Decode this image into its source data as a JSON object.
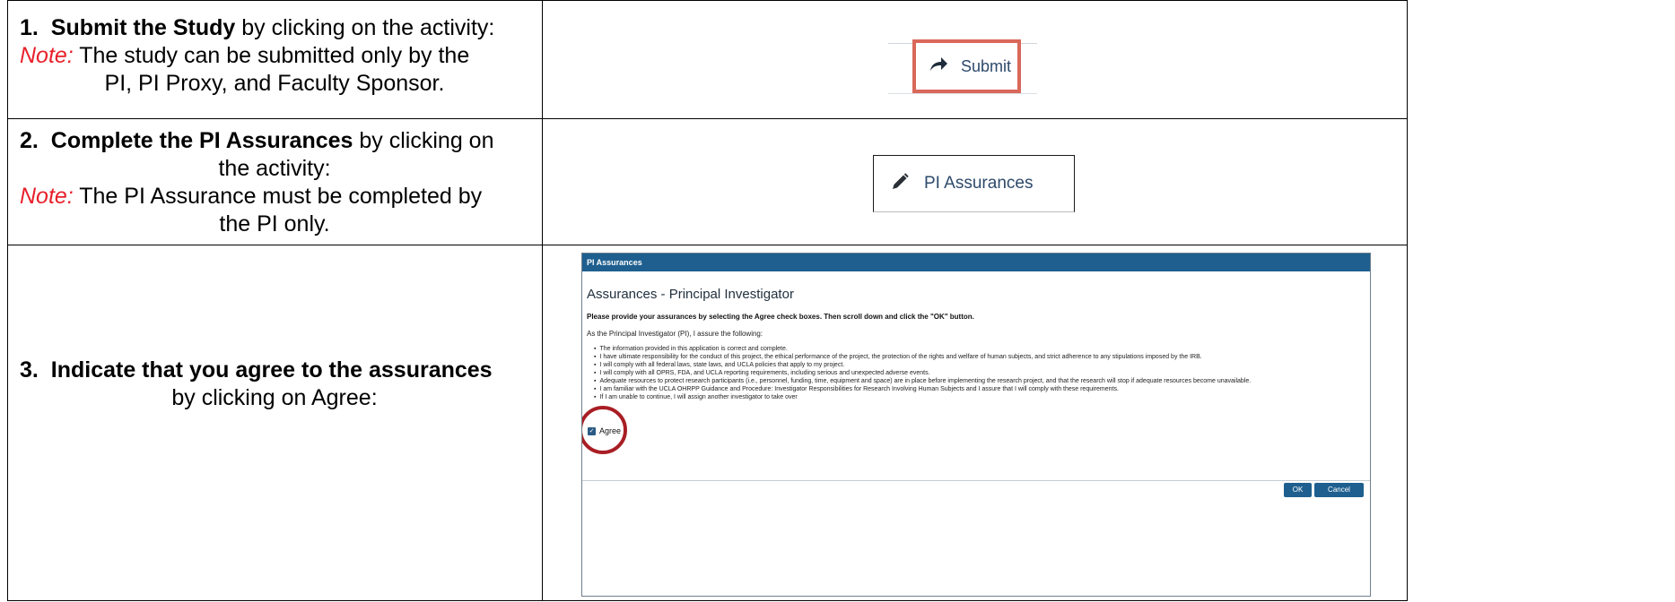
{
  "rows": [
    {
      "num": "1.",
      "title": "Submit the Study",
      "title_rest": " by clicking on the activity:",
      "note_label": "Note:",
      "note_text": " The study can be submitted only by the",
      "note_text2": "PI, PI Proxy, and Faculty Sponsor."
    },
    {
      "num": "2.",
      "title": "Complete the PI Assurances",
      "title_rest": " by clicking on",
      "title_rest2": "the activity:",
      "note_label": "Note:",
      "note_text": " The PI Assurance must be completed by",
      "note_text2": "the PI only."
    },
    {
      "num": "3.",
      "title": "Indicate that you agree to the assurances",
      "title_rest": "by clicking on Agree:"
    }
  ],
  "submit_image": {
    "label": "Submit",
    "icon": "share-arrow-icon"
  },
  "pi_assurances_image": {
    "label": "PI Assurances",
    "icon": "pencil-icon"
  },
  "dialog": {
    "header": "PI Assurances",
    "title": "Assurances - Principal Investigator",
    "instruction": "Please provide your assurances by selecting the Agree check boxes. Then scroll down and click the \"OK\" button.",
    "intro": "As the Principal Investigator (PI), I assure the following:",
    "items": [
      "The information provided in this application is correct and complete.",
      "I have ultimate responsibility for the conduct of this project, the ethical performance of the project, the protection of the rights and welfare of human subjects, and strict adherence to any stipulations imposed by the IRB.",
      "I will comply with all federal laws, state laws, and UCLA policies that apply to my project.",
      "I will comply with all OPRS, FDA, and UCLA reporting requirements, including serious and unexpected adverse events.",
      "Adequate resources to protect research participants (i.e., personnel, funding, time, equipment and space) are in place before implementing the research project, and that the research will stop if adequate resources become unavailable.",
      "I am familiar with the UCLA OHRPP Guidance and Procedure: Investigator Responsibilities for Research Involving Human Subjects and I assure that I will comply with these requirements.",
      "If I am unable to continue, I will assign another investigator to take over"
    ],
    "agree_label": "Agree",
    "ok_label": "OK",
    "cancel_label": "Cancel"
  },
  "colors": {
    "note": "#e8202a",
    "dialog_header": "#1e5f8f",
    "highlight_box": "#d9685a",
    "highlight_circle": "#a81e24"
  }
}
